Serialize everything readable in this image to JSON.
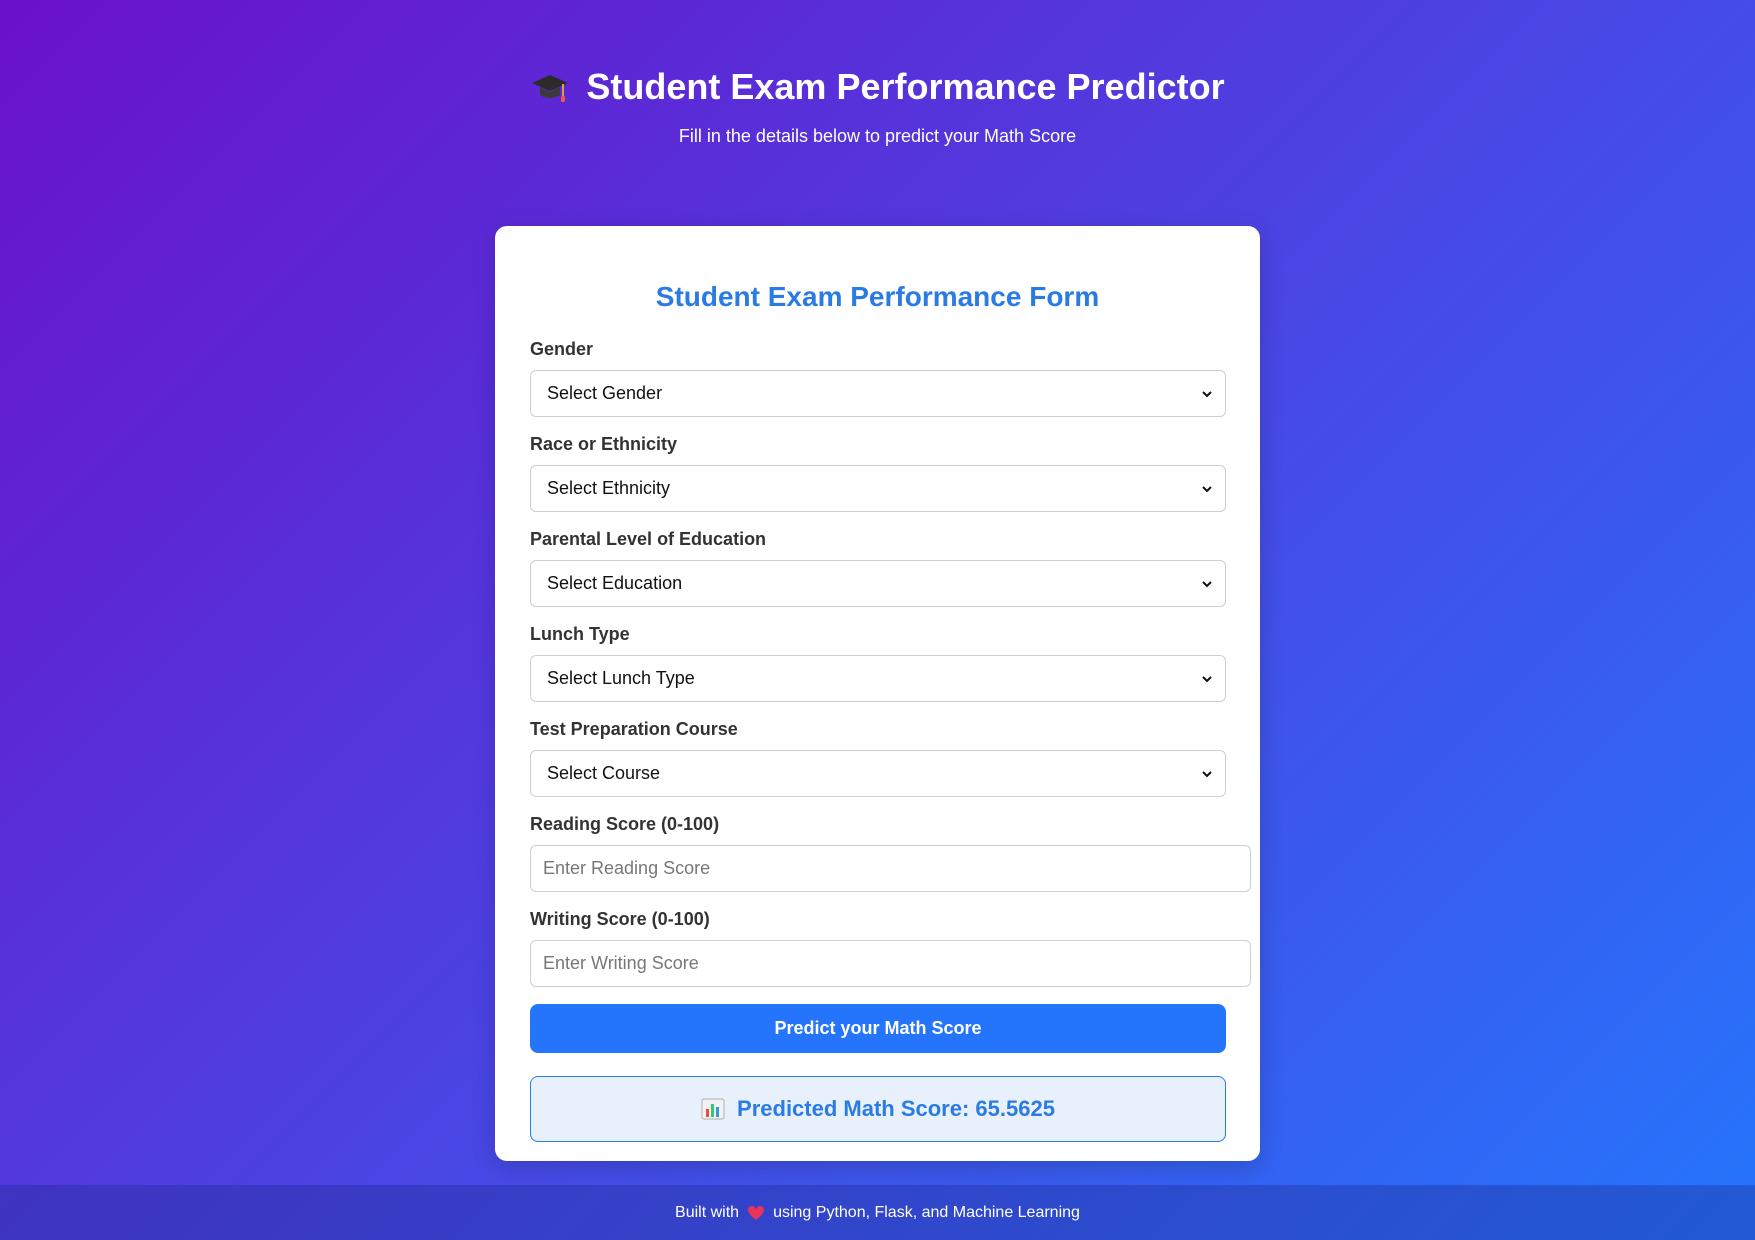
{
  "header": {
    "title": "Student Exam Performance Predictor",
    "subtitle": "Fill in the details below to predict your Math Score",
    "icon": "graduation-cap-icon"
  },
  "form": {
    "title": "Student Exam Performance Form",
    "fields": {
      "gender": {
        "label": "Gender",
        "selected": "Select Gender"
      },
      "ethnicity": {
        "label": "Race or Ethnicity",
        "selected": "Select Ethnicity"
      },
      "education": {
        "label": "Parental Level of Education",
        "selected": "Select Education"
      },
      "lunch": {
        "label": "Lunch Type",
        "selected": "Select Lunch Type"
      },
      "course": {
        "label": "Test Preparation Course",
        "selected": "Select Course"
      },
      "reading": {
        "label": "Reading Score (0-100)",
        "value": "",
        "placeholder": "Enter Reading Score"
      },
      "writing": {
        "label": "Writing Score (0-100)",
        "value": "",
        "placeholder": "Enter Writing Score"
      }
    },
    "submit_label": "Predict your Math Score",
    "result": {
      "text": "Predicted Math Score: 65.5625",
      "icon": "bar-chart-icon"
    }
  },
  "footer": {
    "prefix": "Built with",
    "icon": "heart-icon",
    "suffix": "using Python, Flask, and Machine Learning"
  },
  "colors": {
    "background_start": "#6a11cb",
    "background_end": "#2575fc",
    "accent": "#2a7be4",
    "button": "#2575fc",
    "result_bg": "#e8f0fb"
  }
}
